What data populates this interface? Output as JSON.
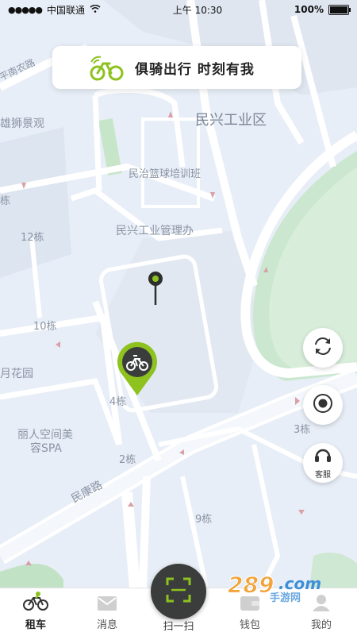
{
  "status_bar": {
    "signal_dots": "●●●●●",
    "carrier": "中国联通",
    "time": "上午 10:30",
    "battery": "100%"
  },
  "slogan": {
    "text": "俱骑出行 时刻有我",
    "logo_icon": "bike-wifi-logo-icon",
    "brand_color": "#8dc21f"
  },
  "map": {
    "labels": [
      "民兴工业区",
      "雄狮景观",
      "民治篮球培训班",
      "民兴工业管理办",
      "12栋",
      "10栋",
      "月花园",
      "4栋",
      "丽人空间美",
      "容SPA",
      "2栋",
      "3栋",
      "9栋",
      "民康路",
      "平南农路",
      "栋"
    ]
  },
  "controls": {
    "refresh_icon": "refresh-icon",
    "locate_icon": "locate-icon",
    "service_label": "客服",
    "service_icon": "headset-icon"
  },
  "tabs": [
    {
      "label": "租车",
      "icon": "bike-icon",
      "active": true
    },
    {
      "label": "消息",
      "icon": "mail-icon",
      "active": false
    },
    {
      "label": "扫一扫",
      "icon": "scan-icon",
      "active": false
    },
    {
      "label": "钱包",
      "icon": "wallet-icon",
      "active": false
    },
    {
      "label": "我的",
      "icon": "user-icon",
      "active": false
    }
  ],
  "watermark": {
    "text": "289.com 手游网"
  }
}
